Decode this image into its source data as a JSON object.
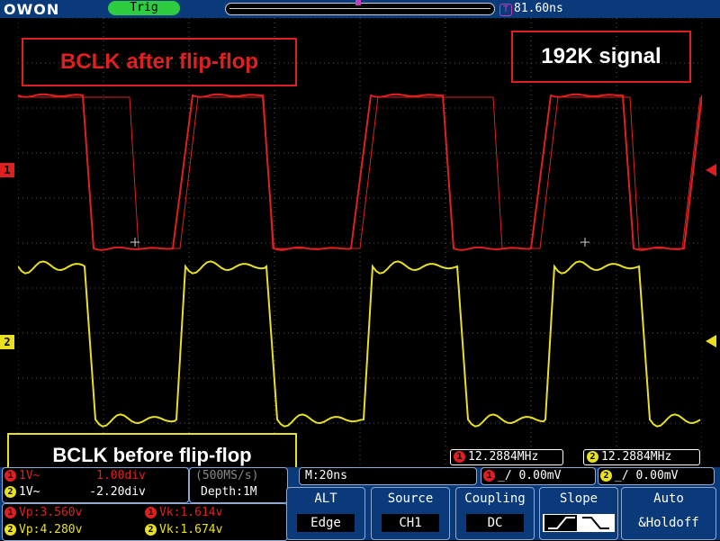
{
  "header": {
    "brand": "OWON",
    "trigger_status": "Trig",
    "trigger_offset_icon": "T",
    "trigger_offset": "81.60ns"
  },
  "annotations": {
    "after": "BCLK after flip-flop",
    "rate": "192K signal",
    "before": "BCLK before flip-flop"
  },
  "channels": {
    "ch1": {
      "label": "1",
      "color": "#e02020"
    },
    "ch2": {
      "label": "2",
      "color": "#e8e020"
    }
  },
  "frequency": {
    "ch1": "12.2884MHz",
    "ch2": "12.2884MHz"
  },
  "status": {
    "ch1_row": "1V~        1.00div",
    "ch2_row": "1V~       -2.20div",
    "sample_rate": "(500MS/s)",
    "depth": "Depth:1M",
    "timebase": "M:20ns",
    "trig1": "0.00mV",
    "trig2": "0.00mV"
  },
  "measurements": {
    "ch1_vp": "Vp:3.560v",
    "ch1_vk": "Vk:1.614v",
    "ch2_vp": "Vp:4.280v",
    "ch2_vk": "Vk:1.674v"
  },
  "menu": {
    "alt": {
      "title": "ALT",
      "value": "Edge"
    },
    "source": {
      "title": "Source",
      "value": "CH1"
    },
    "coupling": {
      "title": "Coupling",
      "value": "DC"
    },
    "slope": {
      "title": "Slope",
      "value": ""
    },
    "auto": {
      "title": "Auto",
      "value": "&Holdoff"
    }
  },
  "icons": [
    "trigger-offset-icon",
    "ch1-marker-icon",
    "ch2-marker-icon",
    "ch1-trigger-arrow-icon",
    "ch2-trigger-arrow-icon",
    "rising-edge-icon",
    "falling-edge-icon"
  ]
}
